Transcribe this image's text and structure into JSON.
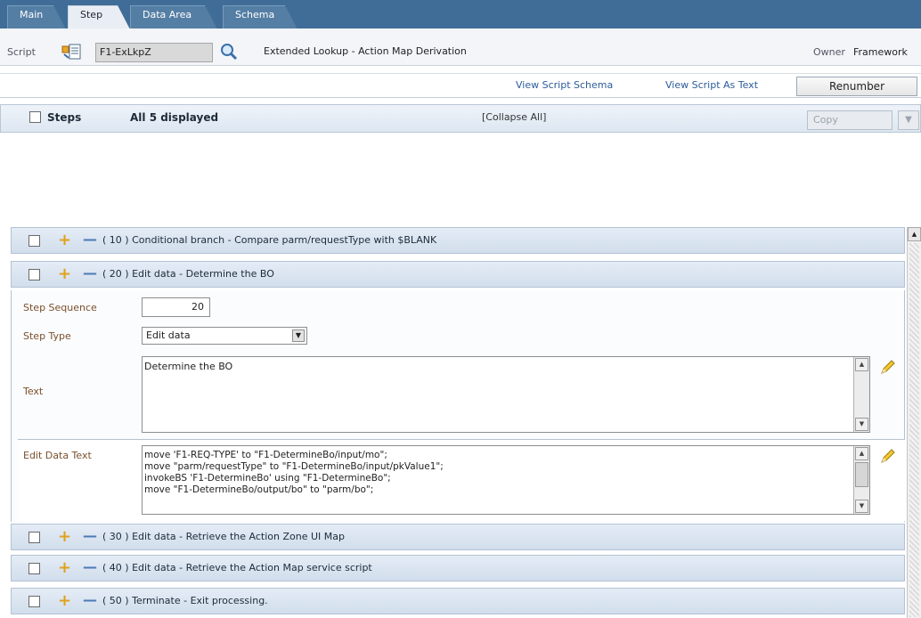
{
  "tabs": [
    {
      "label": "Main",
      "active": false
    },
    {
      "label": "Step",
      "active": true
    },
    {
      "label": "Data Area",
      "active": false
    },
    {
      "label": "Schema",
      "active": false
    }
  ],
  "script": {
    "label": "Script",
    "value": "F1-ExLkpZ",
    "description": "Extended Lookup - Action Map Derivation",
    "owner_label": "Owner",
    "owner_value": "Framework"
  },
  "links": {
    "view_schema": "View Script Schema",
    "view_text": "View Script As Text",
    "renumber": "Renumber"
  },
  "steps_header": {
    "title": "Steps",
    "count": "All 5 displayed",
    "collapse": "[Collapse All]",
    "copy": "Copy"
  },
  "steps": [
    {
      "seq": "10",
      "text": "Conditional branch - Compare parm/requestType with $BLANK"
    },
    {
      "seq": "20",
      "text": "Edit data - Determine the BO"
    },
    {
      "seq": "30",
      "text": "Edit data - Retrieve the Action Zone UI Map"
    },
    {
      "seq": "40",
      "text": "Edit data - Retrieve the Action Map service script"
    },
    {
      "seq": "50",
      "text": "Terminate - Exit processing."
    }
  ],
  "detail": {
    "seq_label": "Step Sequence",
    "seq_value": "20",
    "type_label": "Step Type",
    "type_value": "Edit data",
    "text_label": "Text",
    "text_value": "Determine the BO",
    "edit_label": "Edit Data Text",
    "edit_lines": [
      "move 'F1-REQ-TYPE' to \"F1-DetermineBo/input/mo\";",
      "move \"parm/requestType\" to \"F1-DetermineBo/input/pkValue1\";",
      "invokeBS 'F1-DetermineBo' using \"F1-DetermineBo\";",
      "move \"F1-DetermineBo/output/bo\" to \"parm/bo\";"
    ]
  },
  "colors": {
    "tabbar": "#3f6d97",
    "step_row": "#d2deec",
    "plus": "#e0a11e",
    "minus": "#4d7ab8"
  },
  "icons": [
    "script-lookup-icon",
    "search-icon",
    "plus-icon",
    "minus-icon",
    "pencil-icon",
    "checkbox"
  ]
}
